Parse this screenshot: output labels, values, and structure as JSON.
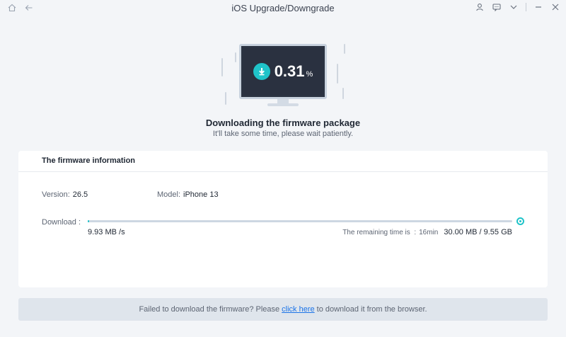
{
  "window": {
    "title": "iOS Upgrade/Downgrade"
  },
  "titlebar_icons": {
    "left": [
      "home-icon",
      "back-icon"
    ],
    "right": [
      "user-icon",
      "feedback-icon",
      "menu-chevron-icon",
      "minimize-icon",
      "close-icon"
    ]
  },
  "status": {
    "percent_value": "0.31",
    "percent_unit": "%",
    "title": "Downloading the firmware package",
    "subtitle": "It'll take some time, please wait patiently."
  },
  "firmware": {
    "header": "The firmware information",
    "version_label": "Version:",
    "version_value": "26.5",
    "model_label": "Model:",
    "model_value": "iPhone 13",
    "download_label": "Download :",
    "progress_fraction": 0.0031,
    "speed": "9.93 MB /s",
    "remaining_label": "The remaining time is  :",
    "remaining_time": "16min",
    "downloaded_size": "30.00 MB / 9.55 GB"
  },
  "footer": {
    "text_before": "Failed to download the firmware? Please",
    "link_text": "click here",
    "text_after": "to download it from the browser."
  },
  "colors": {
    "accent": "#1fc3c9",
    "link": "#1a73e8",
    "background": "#f3f5f8",
    "screen": "#2a3140"
  }
}
